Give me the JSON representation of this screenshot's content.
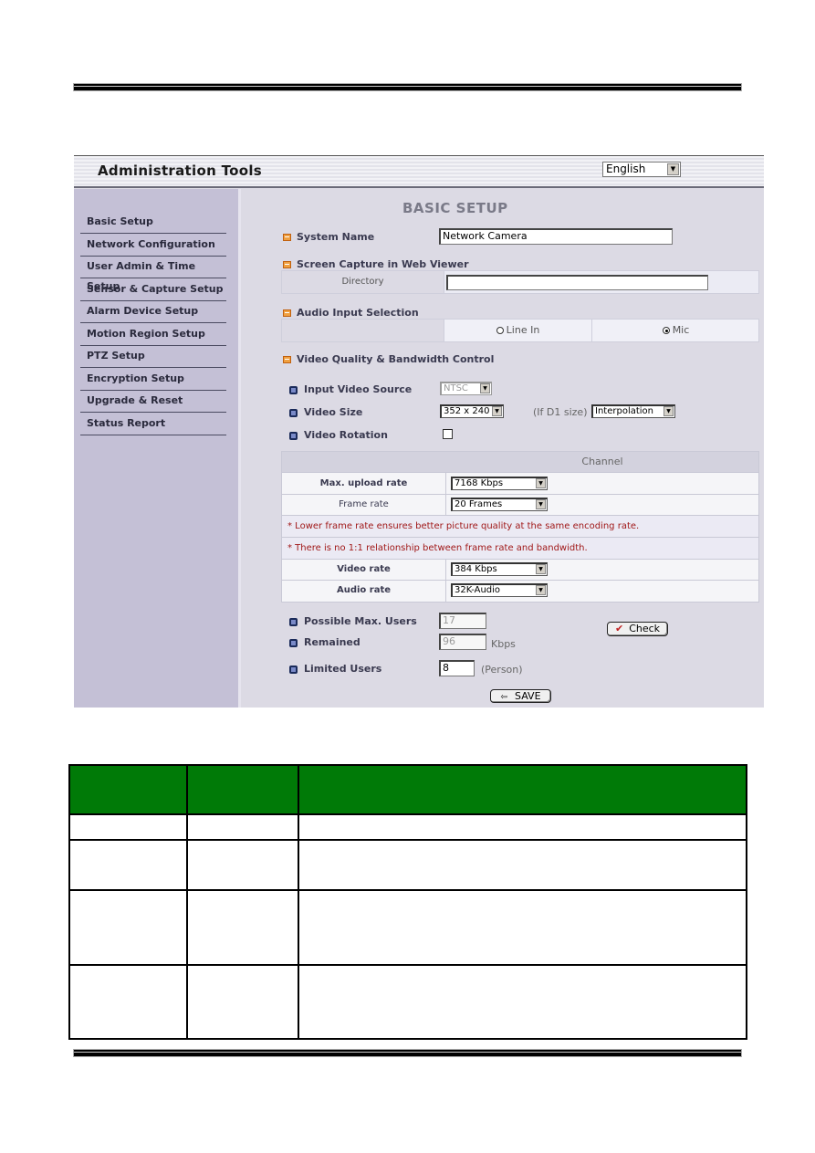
{
  "admin": {
    "title": "Administration Tools",
    "language": {
      "selected": "English"
    },
    "sidebar": {
      "items": [
        {
          "label": "Basic Setup"
        },
        {
          "label": "Network Configuration"
        },
        {
          "label": "User Admin & Time Setup"
        },
        {
          "label": "Sensor & Capture Setup"
        },
        {
          "label": "Alarm Device Setup"
        },
        {
          "label": "Motion Region Setup"
        },
        {
          "label": "PTZ Setup"
        },
        {
          "label": "Encryption Setup"
        },
        {
          "label": "Upgrade & Reset"
        },
        {
          "label": "Status Report"
        }
      ]
    },
    "page_title": "BASIC SETUP",
    "system_name": {
      "label": "System Name",
      "value": "Network Camera"
    },
    "screen_capture": {
      "label": "Screen Capture in Web Viewer",
      "directory_label": "Directory",
      "directory_value": ""
    },
    "audio_input": {
      "label": "Audio Input Selection",
      "options": [
        "Line In",
        "Mic"
      ],
      "selected": "Mic"
    },
    "video_quality": {
      "label": "Video Quality & Bandwidth Control",
      "input_video_source": {
        "label": "Input Video Source",
        "value": "NTSC"
      },
      "video_size": {
        "label": "Video Size",
        "value": "352 x 240",
        "d1_label": "(If D1 size)",
        "d1_value": "Interpolation"
      },
      "video_rotation": {
        "label": "Video Rotation",
        "checked": false
      },
      "channel_header": "Channel",
      "max_upload_rate": {
        "label": "Max. upload rate",
        "value": "7168 Kbps"
      },
      "frame_rate": {
        "label": "Frame rate",
        "value": "20 Frames"
      },
      "notes": [
        "* Lower frame rate ensures better picture quality at the same encoding rate.",
        "* There is no 1:1 relationship between frame rate and bandwidth."
      ],
      "video_rate": {
        "label": "Video rate",
        "value": "384 Kbps"
      },
      "audio_rate": {
        "label": "Audio rate",
        "value": "32K-Audio"
      }
    },
    "possible_max_users": {
      "label": "Possible Max. Users",
      "value": "17"
    },
    "remained": {
      "label": "Remained",
      "value": "96",
      "unit": "Kbps"
    },
    "limited_users": {
      "label": "Limited Users",
      "value": "8",
      "unit": "(Person)"
    },
    "check_button": "Check",
    "save_button": "SAVE"
  },
  "colors": {
    "table_header": "#007a07",
    "sidebar_bg": "#c4c0d6",
    "content_bg": "#dcdae4",
    "note_text": "#a01818",
    "section_icon": "#f0a040"
  }
}
